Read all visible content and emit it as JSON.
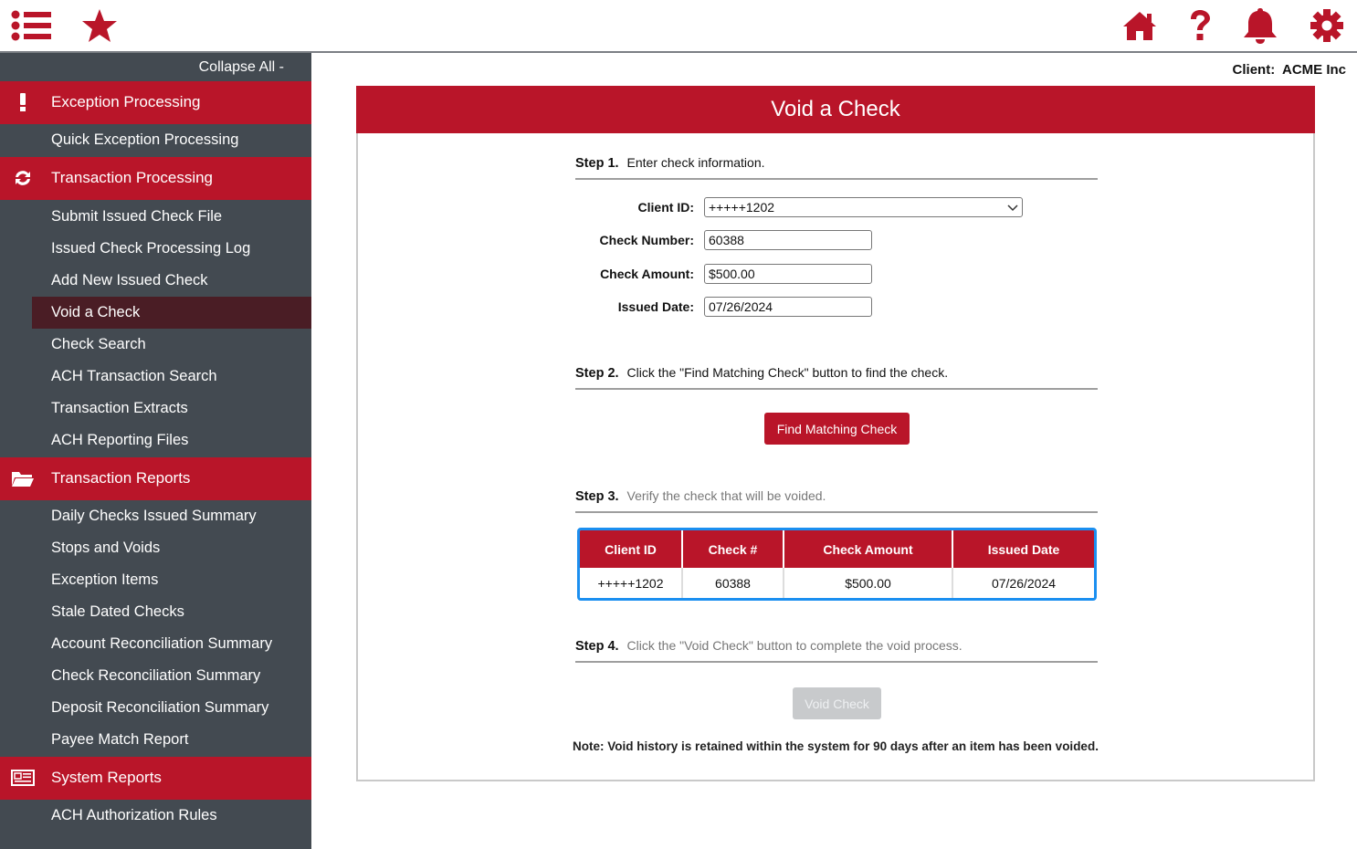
{
  "topbar": {
    "left_icons": [
      "list-icon",
      "star-icon"
    ],
    "right_icons": [
      "home-icon",
      "help-icon",
      "bell-icon",
      "gear-icon"
    ]
  },
  "colors": {
    "brand_red": "#b91529",
    "sidebar_bg": "#434a51",
    "active_item_bg": "#4a1d25",
    "table_focus": "#1b8ff0"
  },
  "sidebar": {
    "collapse_label": "Collapse All -",
    "sections": [
      {
        "label": "Exception Processing",
        "icon": "exclamation-icon",
        "items": [
          "Quick Exception Processing"
        ]
      },
      {
        "label": "Transaction Processing",
        "icon": "refresh-icon",
        "items": [
          "Submit Issued Check File",
          "Issued Check Processing Log",
          "Add New Issued Check",
          "Void a Check",
          "Check Search",
          "ACH Transaction Search",
          "Transaction Extracts",
          "ACH Reporting Files"
        ]
      },
      {
        "label": "Transaction Reports",
        "icon": "folder-open-icon",
        "items": [
          "Daily Checks Issued Summary",
          "Stops and Voids",
          "Exception Items",
          "Stale Dated Checks",
          "Account Reconciliation Summary",
          "Check Reconciliation Summary",
          "Deposit Reconciliation Summary",
          "Payee Match Report"
        ]
      },
      {
        "label": "System Reports",
        "icon": "newspaper-icon",
        "items": [
          "ACH Authorization Rules"
        ]
      }
    ],
    "active_item": "Void a Check"
  },
  "header": {
    "client_label": "Client:",
    "client_name": "ACME Inc"
  },
  "panel": {
    "title": "Void a Check",
    "step1": {
      "label": "Step 1.",
      "text": "Enter check information."
    },
    "fields": {
      "client_id": {
        "label": "Client ID:",
        "value": "+++++1202"
      },
      "check_number": {
        "label": "Check Number:",
        "value": "60388"
      },
      "check_amount": {
        "label": "Check Amount:",
        "value": "$500.00"
      },
      "issued_date": {
        "label": "Issued Date:",
        "value": "07/26/2024"
      }
    },
    "step2": {
      "label": "Step 2.",
      "text": "Click the \"Find Matching Check\" button to find the check."
    },
    "find_button": "Find Matching Check",
    "step3": {
      "label": "Step 3.",
      "text": "Verify the check that will be voided."
    },
    "table": {
      "headers": [
        "Client ID",
        "Check #",
        "Check Amount",
        "Issued Date"
      ],
      "rows": [
        [
          "+++++1202",
          "60388",
          "$500.00",
          "07/26/2024"
        ]
      ]
    },
    "step4": {
      "label": "Step 4.",
      "text": "Click the \"Void Check\" button to complete the void process."
    },
    "void_button": "Void Check",
    "note": "Note: Void history is retained within the system for 90 days after an item has been voided."
  }
}
